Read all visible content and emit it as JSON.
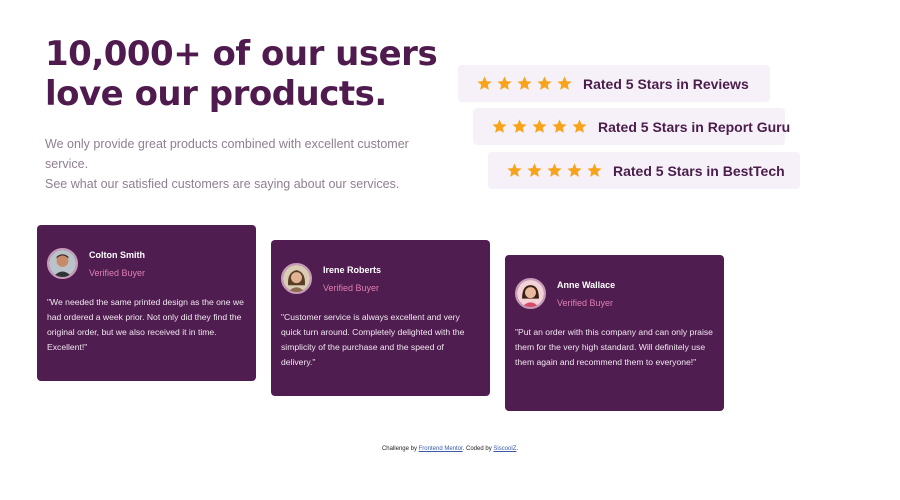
{
  "hero": {
    "title_line1": "10,000+ of our users",
    "title_line2": "love our products.",
    "desc_line1": "We only provide great products combined with excellent customer service.",
    "desc_line2": "See what our satisfied customers are saying about our services."
  },
  "ratings": [
    {
      "label": "Rated 5 Stars in Reviews",
      "stars": 5
    },
    {
      "label": "Rated 5 Stars in Report Guru",
      "stars": 5
    },
    {
      "label": "Rated 5 Stars in BestTech",
      "stars": 5
    }
  ],
  "colors": {
    "star": "#f7a41c",
    "card_bg": "#4f1d4f",
    "rating_bg": "#f6f1f8",
    "accent_pink": "#e07fb5",
    "heading": "#4f1b4e"
  },
  "testimonials": [
    {
      "name": "Colton Smith",
      "role": "Verified Buyer",
      "quote": "\"We needed the same printed design as the one we had ordered a week prior. Not only did they find the original order, but we also received it in time. Excellent!\"",
      "avatar_icon": "avatar-colton-icon"
    },
    {
      "name": "Irene Roberts",
      "role": "Verified Buyer",
      "quote": "\"Customer service is always excellent and very quick turn around. Completely delighted with the simplicity of the purchase and the speed of delivery.\"",
      "avatar_icon": "avatar-irene-icon"
    },
    {
      "name": "Anne Wallace",
      "role": "Verified Buyer",
      "quote": "\"Put an order with this company and can only praise them for the very high standard. Will definitely use them again and recommend them to everyone!\"",
      "avatar_icon": "avatar-anne-icon"
    }
  ],
  "footer": {
    "prefix": "Challenge by ",
    "link1": "Frontend Mentor",
    "middle": ". Coded by ",
    "link2": "SiscoolZ",
    "suffix": "."
  }
}
